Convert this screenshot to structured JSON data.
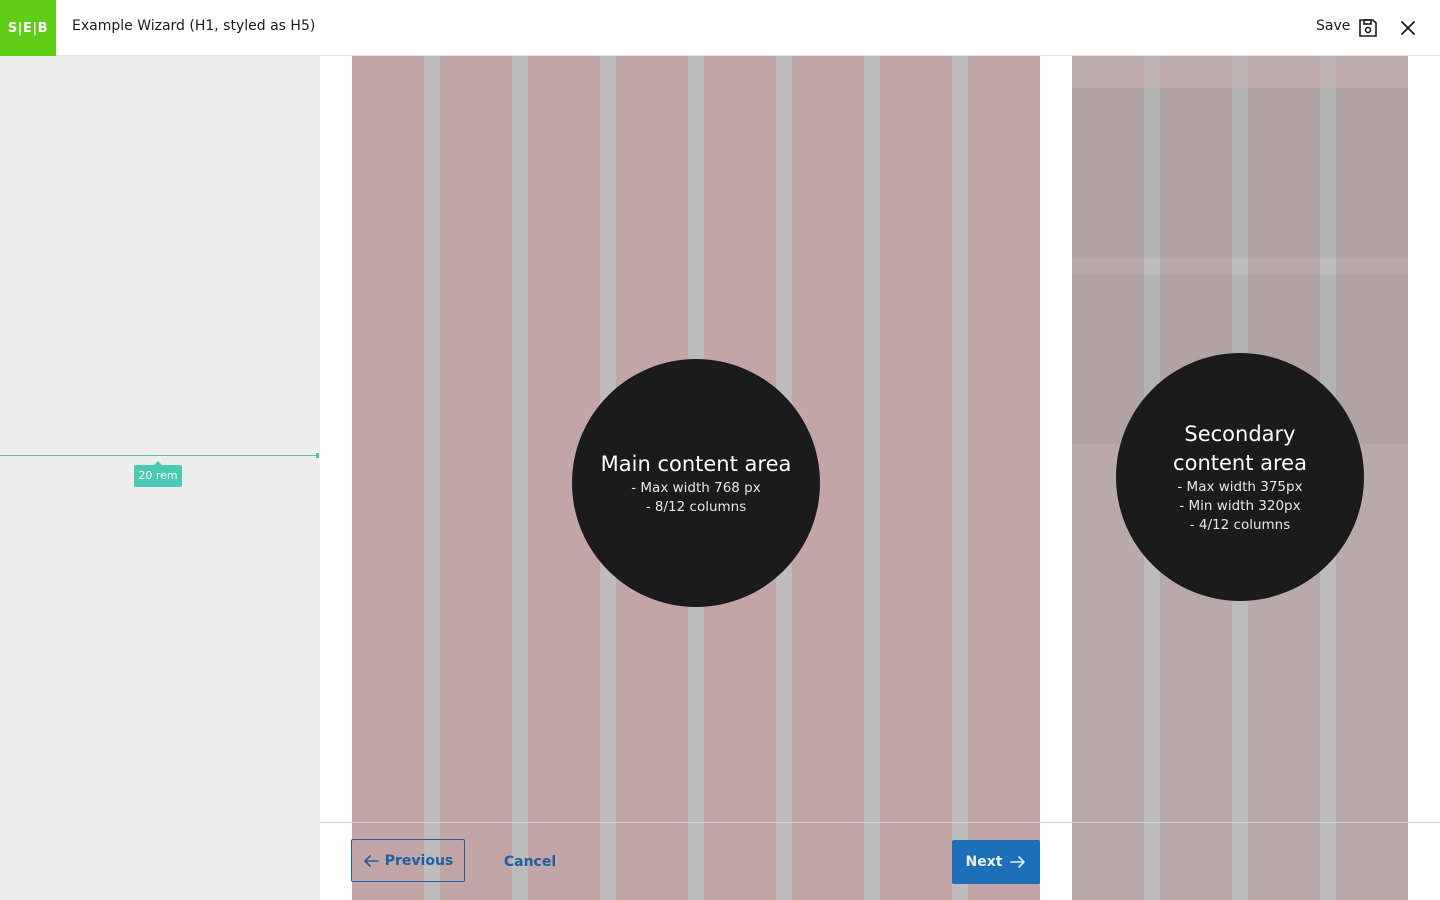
{
  "header": {
    "logo_text": "S|E|B",
    "title": "Example Wizard (H1, styled as H5)",
    "save_label": "Save",
    "icons": {
      "save": "save-icon",
      "close": "close-icon"
    }
  },
  "sidebar": {
    "measure_label": "20 rem"
  },
  "main_area": {
    "heading": "Main content area",
    "lines": [
      "- Max width 768 px",
      "- 8/12 columns"
    ]
  },
  "secondary_area": {
    "heading_line1": "Secondary",
    "heading_line2": "content area",
    "lines": [
      "- Max width 375px",
      "- Min width 320px",
      "- 4/12 columns"
    ]
  },
  "footer": {
    "previous_label": "Previous",
    "cancel_label": "Cancel",
    "next_label": "Next"
  },
  "colors": {
    "brand": "#60cd18",
    "primary": "#1d6fb8",
    "measure": "#48cbb0",
    "sidebar_bg": "#eeeeee",
    "column": "#c2a5a7",
    "gutter": "#bcbcbc"
  }
}
